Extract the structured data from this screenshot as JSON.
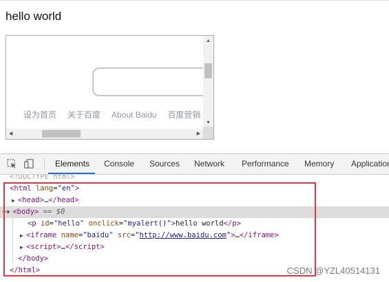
{
  "page": {
    "heading": "hello world"
  },
  "iframe_content": {
    "links": [
      "设为首页",
      "关于百度",
      "About Baidu",
      "百度营销"
    ]
  },
  "devtools": {
    "tabs": [
      "Elements",
      "Console",
      "Sources",
      "Network",
      "Performance",
      "Memory",
      "Application"
    ],
    "active_tab": "Elements",
    "accent_color": "#1a73e8",
    "tree": {
      "doctype": "<!DOCTYPE html>",
      "html_open_tag": "html",
      "html_attr_name": "lang",
      "html_attr_value": "\"en\"",
      "head_tag": "head",
      "body_tag": "body",
      "body_ref": "== $0",
      "p_tag": "p",
      "p_attr_id": "id",
      "p_id_value": "\"hello\"",
      "p_attr_onclick": "onclick",
      "p_onclick_value": "\"myalert()\"",
      "p_text": "hello world",
      "iframe_tag": "iframe",
      "iframe_attr_name": "name",
      "iframe_name_value": "\"baidu\"",
      "iframe_attr_src": "src",
      "iframe_src_value": "http://www.baidu.com",
      "script_tag": "script",
      "body_close": "</body>",
      "html_close": "</html>",
      "ellipsis": "…"
    }
  },
  "annotation": {
    "highlight_color": "#e8323c"
  },
  "watermark": "CSDN @YZL40514131"
}
